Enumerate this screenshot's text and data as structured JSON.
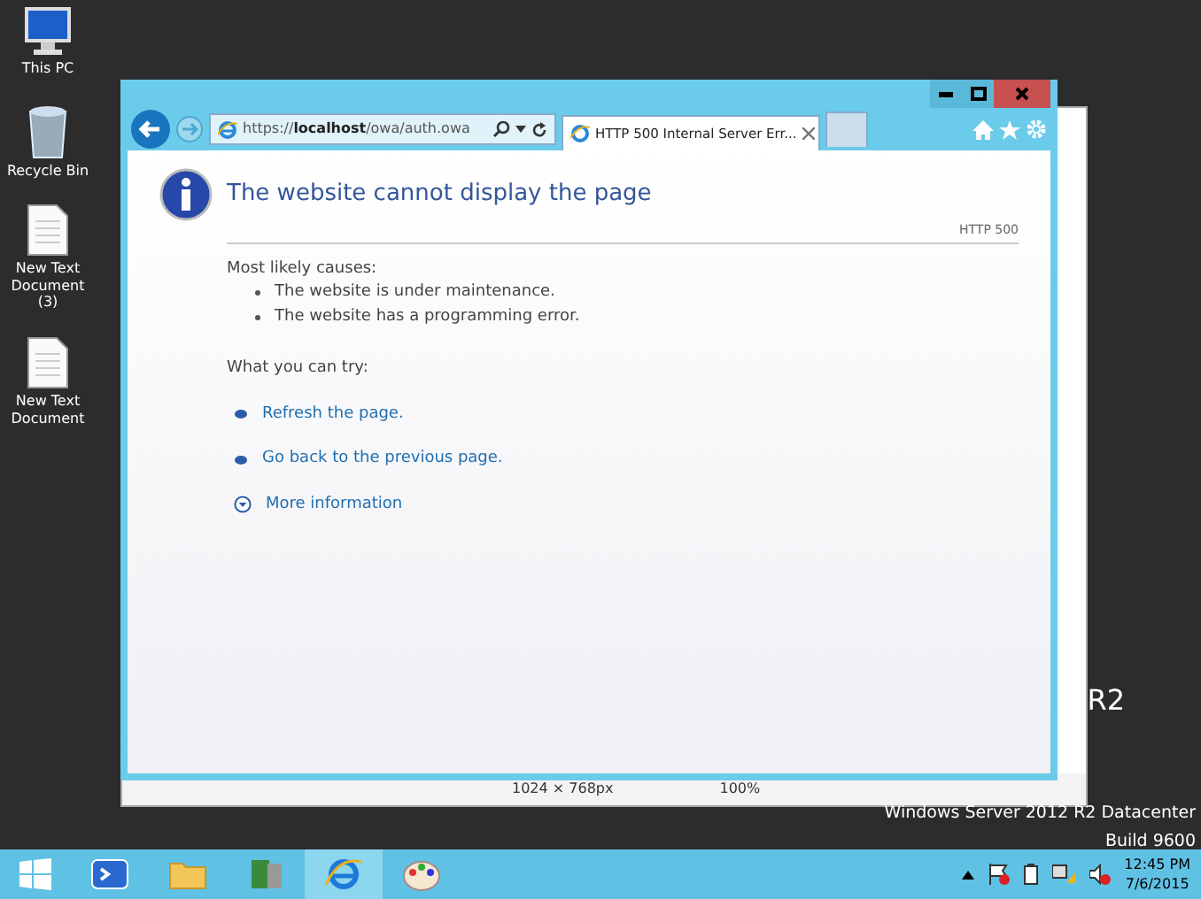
{
  "desktop_icons": [
    {
      "kind": "pc",
      "label": "This PC"
    },
    {
      "kind": "bin",
      "label": "Recycle Bin"
    },
    {
      "kind": "doc",
      "label": "New Text Document (3)"
    },
    {
      "kind": "doc",
      "label": "New Text Document"
    }
  ],
  "background_window": {
    "text_fragment": "R2",
    "status_items": [
      "1024 × 768px",
      "100%"
    ]
  },
  "browser": {
    "address": "https://**localhost**/owa/auth.owa",
    "tabs": [
      {
        "title": "HTTP 500 Internal Server Err...",
        "selected": true
      }
    ],
    "error_page": {
      "heading": "The website cannot display the page",
      "code": "HTTP 500",
      "causes_label": "Most likely causes:",
      "causes": [
        "The website is under maintenance.",
        "The website has a programming error."
      ],
      "try_label": "What you can try:",
      "actions": [
        {
          "kind": "bullet",
          "text": "Refresh the page."
        },
        {
          "kind": "bullet",
          "text": "Go back to the previous page."
        },
        {
          "kind": "expand",
          "text": "More information"
        }
      ]
    }
  },
  "os_info": [
    "Windows Server 2012 R2 Datacenter",
    "Build 9600"
  ],
  "taskbar": {
    "apps": [
      {
        "kind": "powershell",
        "selected": false
      },
      {
        "kind": "folder",
        "selected": false
      },
      {
        "kind": "server",
        "selected": false
      },
      {
        "kind": "ie",
        "selected": true
      },
      {
        "kind": "paint",
        "selected": false
      }
    ],
    "clock": {
      "time": "12:45 PM",
      "date": "7/6/2015"
    }
  }
}
